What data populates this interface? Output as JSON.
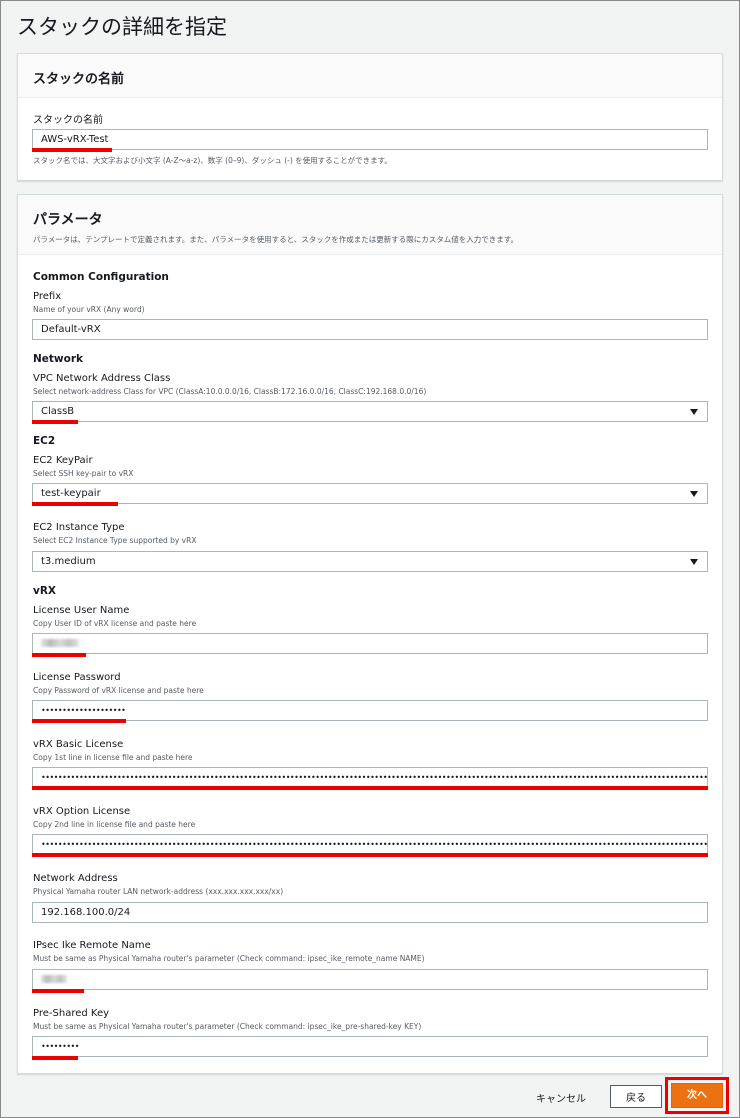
{
  "page_title": "スタックの詳細を指定",
  "stack_panel": {
    "header": "スタックの名前",
    "label": "スタックの名前",
    "value": "AWS-vRX-Test",
    "hint": "スタック名では、大文字および小文字 (A-Z～a-z)、数字 (0–9)、ダッシュ (-) を使用することができます。"
  },
  "params_panel": {
    "header": "パラメータ",
    "description": "パラメータは、テンプレートで定義されます。また、パラメータを使用すると、スタックを作成または更新する際にカスタム値を入力できます。",
    "groups": {
      "common": "Common Configuration",
      "network": "Network",
      "ec2": "EC2",
      "vrx": "vRX"
    },
    "prefix": {
      "label": "Prefix",
      "hint": "Name of your vRX (Any word)",
      "value": "Default-vRX"
    },
    "vpc_class": {
      "label": "VPC Network Address Class",
      "hint": "Select network-address Class for VPC (ClassA:10.0.0.0/16, ClassB:172.16.0.0/16, ClassC:192.168.0.0/16)",
      "value": "ClassB"
    },
    "keypair": {
      "label": "EC2 KeyPair",
      "hint": "Select SSH key-pair to vRX",
      "value": "test-keypair"
    },
    "instance_type": {
      "label": "EC2 Instance Type",
      "hint": "Select EC2 Instance Type supported by vRX",
      "value": "t3.medium"
    },
    "license_user": {
      "label": "License User Name",
      "hint": "Copy User ID of vRX license and paste here"
    },
    "license_password": {
      "label": "License Password",
      "hint": "Copy Password of vRX license and paste here",
      "value": "••••••••••••••••••••"
    },
    "basic_license": {
      "label": "vRX Basic License",
      "hint": "Copy 1st line in license file and paste here",
      "value": "••••••••••••••••••••••••••••••••••••••••••••••••••••••••••••••••••••••••••••••••••••••••••••••••••••••••••••••••••••••••••••••••••••••••••••••••••••••••••••••••••"
    },
    "option_license": {
      "label": "vRX Option License",
      "hint": "Copy 2nd line in license file and paste here",
      "value": "••••••••••••••••••••••••••••••••••••••••••••••••••••••••••••••••••••••••••••••••••••••••••••••••••••••••••••••••••••••••••••••••••••••••••••••••••••••••••••••••••"
    },
    "network_address": {
      "label": "Network Address",
      "hint": "Physical Yamaha router LAN network-address (xxx.xxx.xxx.xxx/xx)",
      "value": "192.168.100.0/24"
    },
    "ipsec_name": {
      "label": "IPsec Ike Remote Name",
      "hint": "Must be same as Physical Yamaha router's parameter (Check command: ipsec_ike_remote_name NAME)"
    },
    "psk": {
      "label": "Pre-Shared Key",
      "hint": "Must be same as Physical Yamaha router's parameter (Check command: ipsec_ike_pre-shared-key KEY)",
      "value": "•••••••••"
    }
  },
  "footer": {
    "cancel": "キャンセル",
    "back": "戻る",
    "next": "次へ"
  },
  "colors": {
    "accent": "#ec7211",
    "highlight": "#ee0000"
  }
}
